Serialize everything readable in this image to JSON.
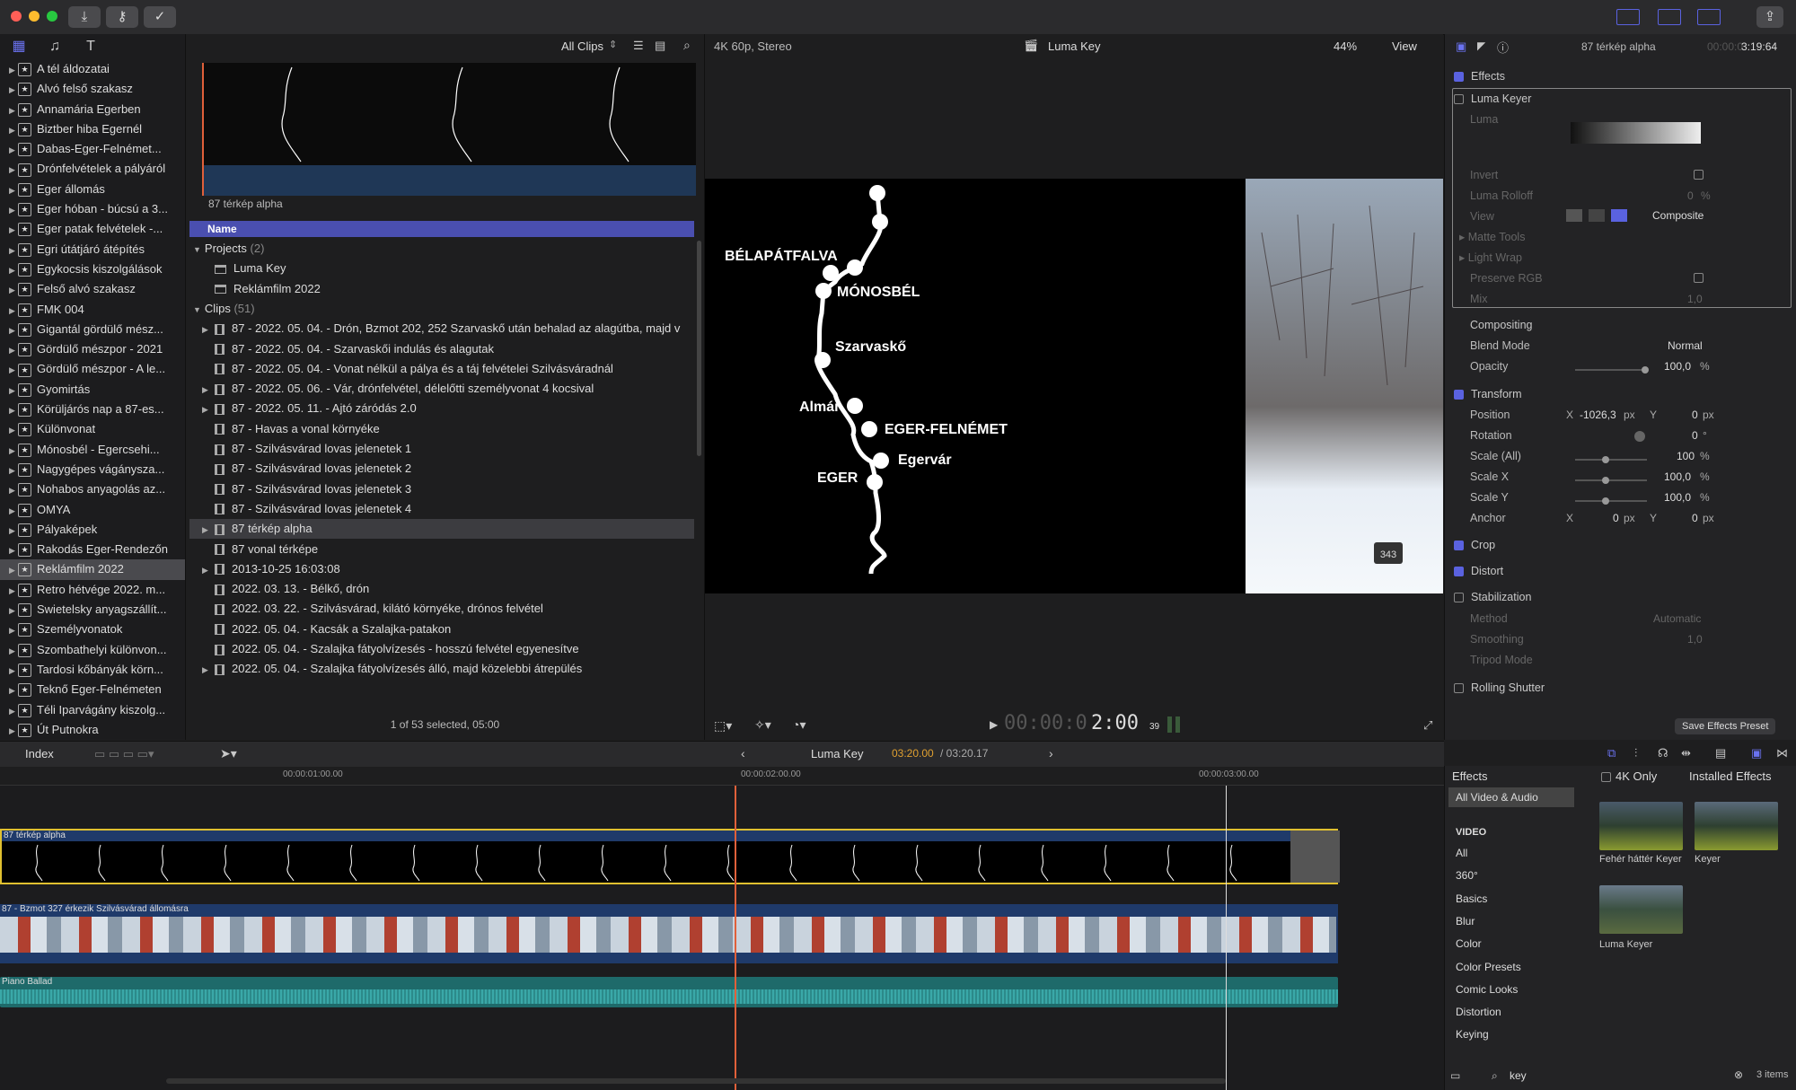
{
  "toolbar": {
    "buttons": [
      "import-icon",
      "keyword-icon",
      "check-icon"
    ],
    "right_buttons": [
      "layout-browser-icon",
      "layout-timeline-icon",
      "layout-inspector-icon",
      "share-icon"
    ]
  },
  "library": {
    "events": [
      "A tél áldozatai",
      "Alvó felső szakasz",
      "Annamária Egerben",
      "Biztber hiba Egernél",
      "Dabas-Eger-Felnémet...",
      "Drónfelvételek a pályáról",
      "Eger állomás",
      "Eger hóban - búcsú a 3...",
      "Eger patak felvételek -...",
      "Egri útátjáró átépítés",
      "Egykocsis kiszolgálások",
      "Felső alvó szakasz",
      "FMK 004",
      "Gigantál gördülő mész...",
      "Gördülő mészpor - 2021",
      "Gördülő mészpor - A le...",
      "Gyomirtás",
      "Körüljárós nap a 87-es...",
      "Különvonat",
      "Mónosbél - Egercsehi...",
      "Nagygépes vágányszа...",
      "Nohabos anyagolás az...",
      "OMYA",
      "Pályaképek",
      "Rakodás Eger-Rendezőn",
      "Reklámfilm 2022",
      "Retro hétvége 2022. m...",
      "Swietelsky anyagszállít...",
      "Személyvonatok",
      "Szombathelyi különvon...",
      "Tardosi kőbányák körn...",
      "Teknő Eger-Felnémeten",
      "Téli Iparvágány kiszolg...",
      "Út Putnokra"
    ],
    "selected_index": 25
  },
  "browser": {
    "filter": "All Clips",
    "thumb_title": "87 térkép alpha",
    "column_name": "Name",
    "projects_label": "Projects",
    "projects_count": "(2)",
    "projects": [
      "Luma Key",
      "Reklámfilm 2022"
    ],
    "clips_label": "Clips",
    "clips_count": "(51)",
    "clips": [
      {
        "name": "87 - 2022. 05. 04. - Drón, Bzmot 202, 252 Szarvaskő után behalad az alagútba, majd v",
        "expand": true
      },
      {
        "name": "87 - 2022. 05. 04. - Szarvaskői indulás és alagutak",
        "expand": false
      },
      {
        "name": "87 - 2022. 05. 04. - Vonat nélkül a pálya és a táj felvételei Szilvásváradnál",
        "expand": false
      },
      {
        "name": "87 - 2022. 05. 06. - Vár, drónfelvétel, délelőtti személyvonat 4 kocsival",
        "expand": true
      },
      {
        "name": "87 - 2022. 05. 11. - Ajtó záródás 2.0",
        "expand": true
      },
      {
        "name": "87 - Havas a vonal környéke",
        "expand": false
      },
      {
        "name": "87 - Szilvásvárad lovas jelenetek 1",
        "expand": false
      },
      {
        "name": "87 - Szilvásvárad lovas jelenetek 2",
        "expand": false
      },
      {
        "name": "87 - Szilvásvárad lovas jelenetek 3",
        "expand": false
      },
      {
        "name": "87 - Szilvásvárad lovas jelenetek 4",
        "expand": false
      },
      {
        "name": "87 térkép alpha",
        "expand": true,
        "selected": true
      },
      {
        "name": "87 vonal térképe",
        "expand": false
      },
      {
        "name": "2013-10-25 16:03:08",
        "expand": true
      },
      {
        "name": "2022. 03. 13. - Bélkő, drón",
        "expand": false
      },
      {
        "name": "2022. 03. 22. - Szilvásvárad, kilátó környéke, drónos felvétel",
        "expand": false
      },
      {
        "name": "2022. 05. 04. - Kacsák a Szalajka-patakon",
        "expand": false
      },
      {
        "name": "2022. 05. 04. - Szalajka fátyolvízesés - hosszú felvétel egyenesítve",
        "expand": false
      },
      {
        "name": "2022. 05. 04. - Szalajka fátyolvízesés álló, majd közelebbi átrepülés",
        "expand": true
      }
    ],
    "status": "1 of 53 selected, 05:00"
  },
  "viewer": {
    "format": "4K 60p, Stereo",
    "project": "Luma Key",
    "zoom": "44%",
    "view_label": "View",
    "timecode_dim": "00:00:0",
    "timecode": "2:00",
    "timecode_frames": "39",
    "map_labels": [
      "BÉLAPÁTFALVA",
      "MÓNOSBÉL",
      "Szarvaskő",
      "Almár",
      "EGER-FELNÉMET",
      "Egervár",
      "EGER"
    ],
    "post_number": "343"
  },
  "inspector": {
    "clip_name": "87 térkép alpha",
    "duration_dim": "00:00:0",
    "duration": "3:19:64",
    "effects_label": "Effects",
    "luma_keyer": "Luma Keyer",
    "luma": "Luma",
    "invert": "Invert",
    "luma_rolloff": "Luma Rolloff",
    "luma_rolloff_val": "0",
    "view": "View",
    "view_val": "Composite",
    "matte_tools": "Matte Tools",
    "light_wrap": "Light Wrap",
    "preserve_rgb": "Preserve RGB",
    "mix": "Mix",
    "mix_val": "1,0",
    "compositing": "Compositing",
    "blend_mode": "Blend Mode",
    "blend_mode_val": "Normal",
    "opacity": "Opacity",
    "opacity_val": "100,0",
    "transform": "Transform",
    "position": "Position",
    "pos_x": "-1026,3",
    "pos_y": "0",
    "rotation": "Rotation",
    "rotation_val": "0",
    "scale_all": "Scale (All)",
    "scale_all_val": "100",
    "scale_x": "Scale X",
    "scale_x_val": "100,0",
    "scale_y": "Scale Y",
    "scale_y_val": "100,0",
    "anchor": "Anchor",
    "anchor_x": "0",
    "anchor_y": "0",
    "crop": "Crop",
    "distort": "Distort",
    "stabilization": "Stabilization",
    "method": "Method",
    "method_val": "Automatic",
    "smoothing": "Smoothing",
    "smoothing_val": "1,0",
    "tripod_mode": "Tripod Mode",
    "rolling_shutter": "Rolling Shutter",
    "save_preset": "Save Effects Preset",
    "unit_px": "px",
    "unit_pct": "%",
    "unit_deg": "°",
    "x": "X",
    "y": "Y"
  },
  "timeline": {
    "index": "Index",
    "project": "Luma Key",
    "time_current": "03:20.00",
    "time_total": "/ 03:20.17",
    "ruler": [
      "00:00:01:00.00",
      "00:00:02:00.00",
      "00:00:03:00.00"
    ],
    "clip1": "87 térkép alpha",
    "clip2": "87 - Bzmot 327 érkezik Szilvásvárad állomásra",
    "audio": "Piano Ballad"
  },
  "effects_browser": {
    "title": "Effects",
    "four_k": "4K Only",
    "installed": "Installed Effects",
    "all": "All Video & Audio",
    "video_header": "VIDEO",
    "categories": [
      "All",
      "360°",
      "Basics",
      "Blur",
      "Color",
      "Color Presets",
      "Comic Looks",
      "Distortion",
      "Keying"
    ],
    "items": [
      "Fehér háttér Keyer",
      "Keyer",
      "Luma Keyer"
    ],
    "search": "key",
    "count": "3 items"
  },
  "colors": {
    "accent": "#5a62e0",
    "selection": "#4a4fb0",
    "playhead": "#e0603a",
    "timeline_blue": "#1f3a6a",
    "audio": "#2c8a8a"
  }
}
